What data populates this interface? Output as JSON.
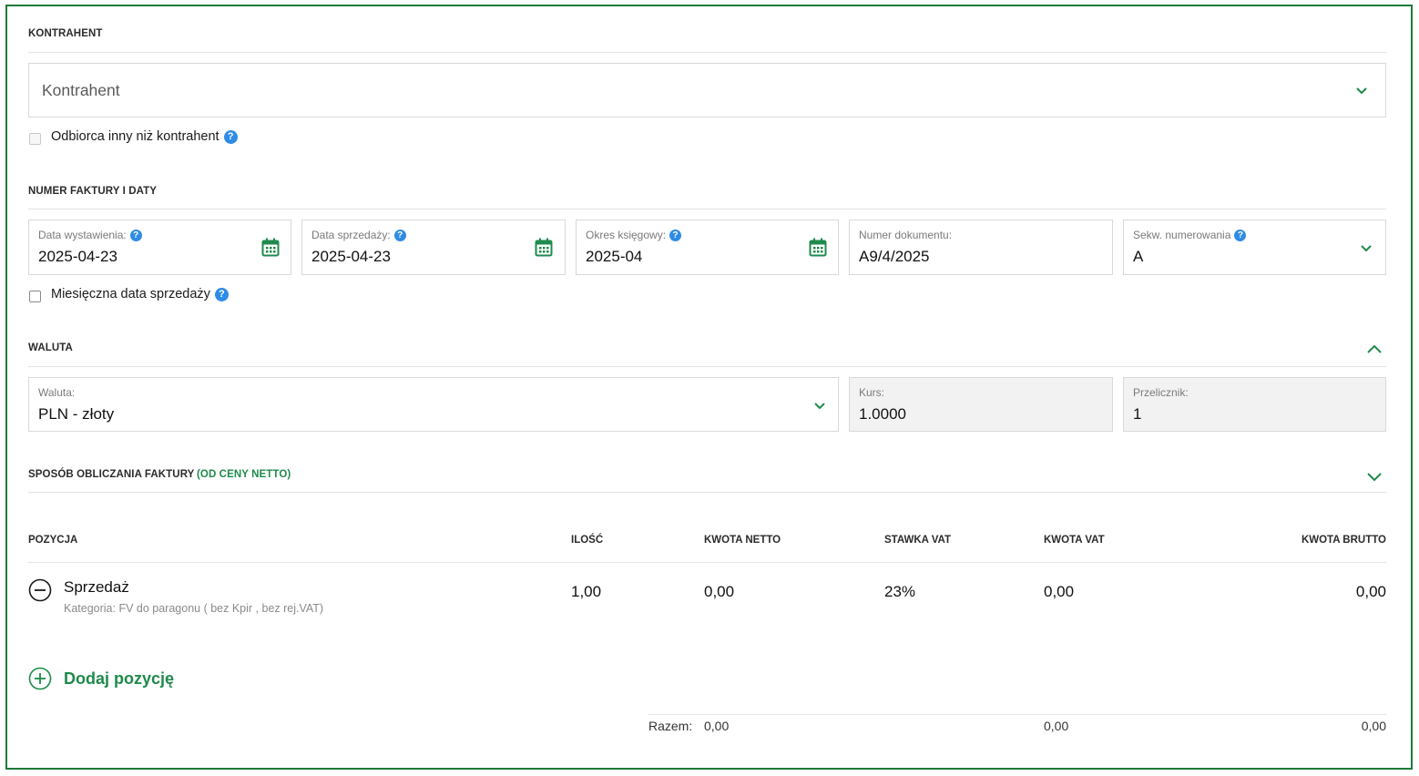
{
  "contractor_section": {
    "title": "KONTRAHENT",
    "select_placeholder": "Kontrahent",
    "other_recipient_label": "Odbiorca inny niż kontrahent",
    "other_recipient_checked": false,
    "other_recipient_disabled": true
  },
  "numbers_section": {
    "title": "NUMER FAKTURY I DATY",
    "issue_date": {
      "label": "Data wystawienia:",
      "value": "2025-04-23"
    },
    "sale_date": {
      "label": "Data sprzedaży:",
      "value": "2025-04-23"
    },
    "accounting_period": {
      "label": "Okres księgowy:",
      "value": "2025-04"
    },
    "document_number": {
      "label": "Numer dokumentu:",
      "value": "A9/4/2025"
    },
    "numbering_sequence": {
      "label": "Sekw. numerowania",
      "value": "A"
    },
    "monthly_sale_date_label": "Miesięczna data sprzedaży",
    "monthly_sale_date_checked": false
  },
  "currency_section": {
    "title": "WALUTA",
    "currency": {
      "label": "Waluta:",
      "value": "PLN - złoty"
    },
    "rate": {
      "label": "Kurs:",
      "value": "1.0000"
    },
    "converter": {
      "label": "Przelicznik:",
      "value": "1"
    }
  },
  "calc_section": {
    "title": "SPOSÓB OBLICZANIA FAKTURY",
    "mode": "(OD CENY NETTO)"
  },
  "items_table": {
    "headers": {
      "position": "POZYCJA",
      "quantity": "ILOŚĆ",
      "net": "KWOTA NETTO",
      "vat_rate": "STAWKA VAT",
      "vat": "KWOTA VAT",
      "gross": "KWOTA BRUTTO"
    },
    "rows": [
      {
        "name": "Sprzedaż",
        "category": "Kategoria: FV do paragonu ( bez Kpir , bez rej.VAT)",
        "quantity": "1,00",
        "net": "0,00",
        "vat_rate": "23%",
        "vat": "0,00",
        "gross": "0,00"
      }
    ],
    "add_item_label": "Dodaj pozycję",
    "totals": {
      "label": "Razem:",
      "net": "0,00",
      "vat": "0,00",
      "gross": "0,00"
    }
  },
  "colors": {
    "accent": "#1f8a4c",
    "frame": "#1f7a3a",
    "help": "#2f8ce6"
  },
  "icons": [
    "chevron-down-icon",
    "chevron-up-icon",
    "calendar-icon",
    "help-icon",
    "remove-circle-icon",
    "add-circle-icon"
  ]
}
